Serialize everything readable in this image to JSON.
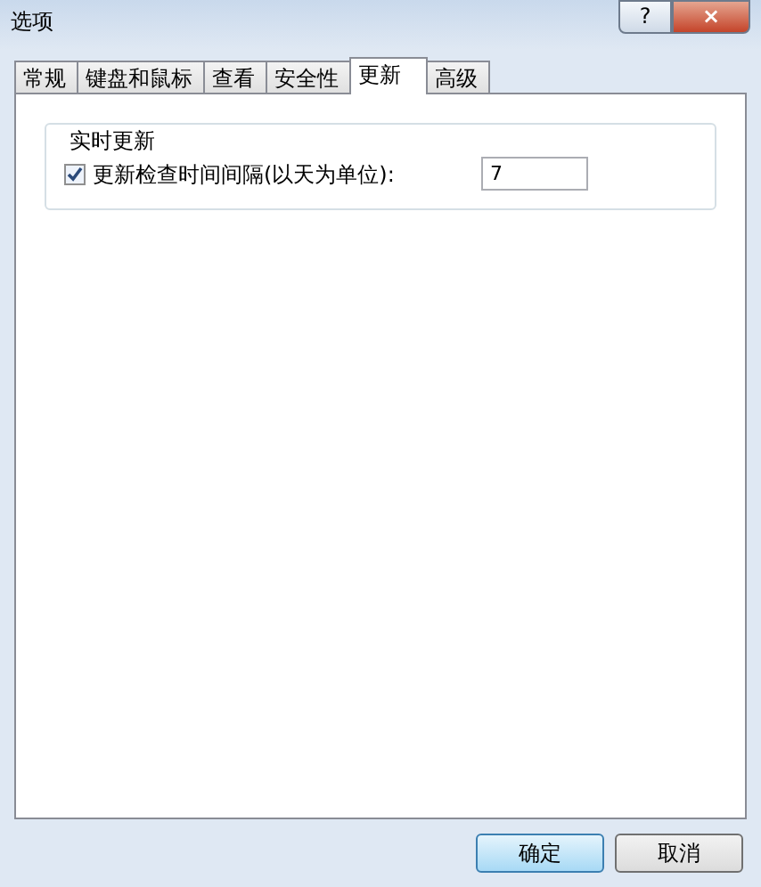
{
  "window": {
    "title": "选项",
    "help": "?",
    "close": "×"
  },
  "tabs": [
    {
      "label": "常规",
      "selected": false
    },
    {
      "label": "键盘和鼠标",
      "selected": false
    },
    {
      "label": "查看",
      "selected": false
    },
    {
      "label": "安全性",
      "selected": false
    },
    {
      "label": "更新",
      "selected": true
    },
    {
      "label": "高级",
      "selected": false
    }
  ],
  "group": {
    "title": "实时更新",
    "checkbox": {
      "label": "更新检查时间间隔(以天为单位):",
      "checked": true
    },
    "value": "7"
  },
  "buttons": [
    "确定",
    "取消"
  ]
}
